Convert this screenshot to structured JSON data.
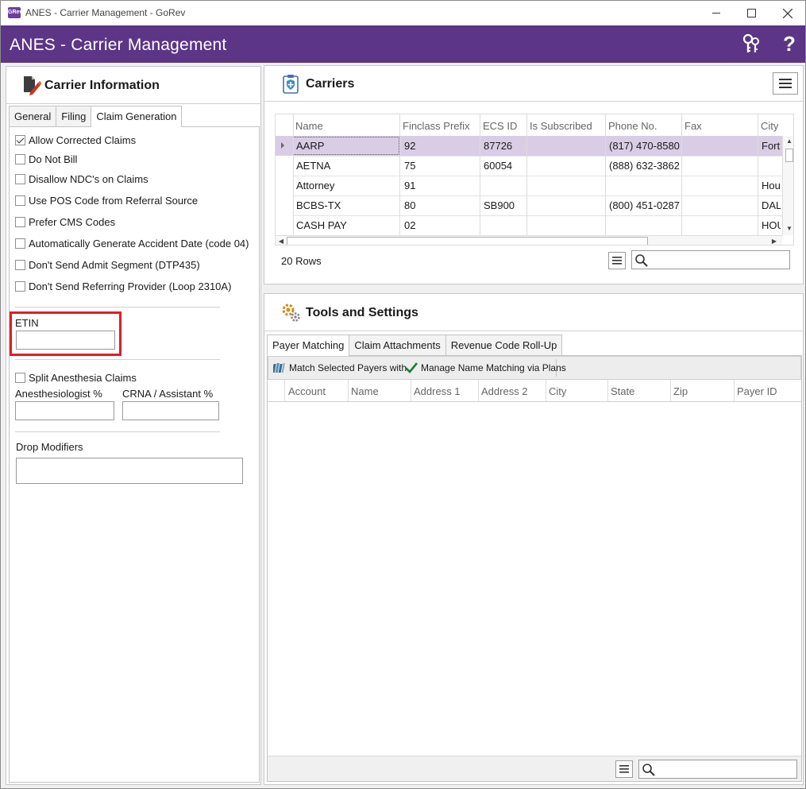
{
  "window": {
    "title": "ANES - Carrier Management - GoRev",
    "logo_text": "GRev"
  },
  "header": {
    "title": "ANES - Carrier Management",
    "help_symbol": "?"
  },
  "carrier_info": {
    "title": "Carrier Information",
    "tabs": [
      "General",
      "Filing",
      "Claim Generation"
    ],
    "active_tab": "Claim Generation",
    "checkboxes": [
      {
        "label": "Allow Corrected Claims",
        "checked": true
      },
      {
        "label": "Do Not Bill",
        "checked": false
      },
      {
        "label": "Disallow NDC's on Claims",
        "checked": false
      },
      {
        "label": "Use POS Code from Referral Source",
        "checked": false
      },
      {
        "label": "Prefer CMS Codes",
        "checked": false
      },
      {
        "label": "Automatically Generate Accident Date (code 04)",
        "checked": false
      },
      {
        "label": "Don't Send Admit Segment (DTP435)",
        "checked": false
      },
      {
        "label": "Don't Send Referring Provider (Loop 2310A)",
        "checked": false
      }
    ],
    "etin_label": "ETIN",
    "etin_value": "",
    "split_anesthesia": {
      "label": "Split Anesthesia Claims",
      "checked": false
    },
    "anesthesiologist_label": "Anesthesiologist %",
    "anesthesiologist_value": "",
    "crna_label": "CRNA / Assistant %",
    "crna_value": "",
    "drop_modifiers_label": "Drop Modifiers",
    "drop_modifiers_value": ""
  },
  "carriers": {
    "title": "Carriers",
    "columns": [
      "Name",
      "Finclass Prefix",
      "ECS ID",
      "Is Subscribed",
      "Phone No.",
      "Fax",
      "City"
    ],
    "rows": [
      [
        "AARP",
        "92",
        "87726",
        "",
        "(817) 470-8580",
        "",
        "Fort"
      ],
      [
        "AETNA",
        "75",
        "60054",
        "",
        "(888) 632-3862",
        "",
        ""
      ],
      [
        "Attorney",
        "91",
        "",
        "",
        "",
        "",
        "Hou"
      ],
      [
        "BCBS-TX",
        "80",
        "SB900",
        "",
        "(800) 451-0287",
        "",
        "DAL"
      ],
      [
        "CASH PAY",
        "02",
        "",
        "",
        "",
        "",
        "HOU"
      ]
    ],
    "selected_row": 0,
    "row_count": "20 Rows",
    "search_value": ""
  },
  "tools": {
    "title": "Tools and Settings",
    "tabs": [
      "Payer Matching",
      "Claim Attachments",
      "Revenue Code Roll-Up"
    ],
    "active_tab": "Payer Matching",
    "actions": [
      "Match Selected Payers with",
      "Manage Name Matching via Plans"
    ],
    "columns": [
      "Account",
      "Name",
      "Address 1",
      "Address 2",
      "City",
      "State",
      "Zip",
      "Payer ID"
    ],
    "search_value": ""
  },
  "colors": {
    "header": "#5d3586",
    "selected_row": "#d9cde6",
    "highlight": "#e01e26"
  }
}
